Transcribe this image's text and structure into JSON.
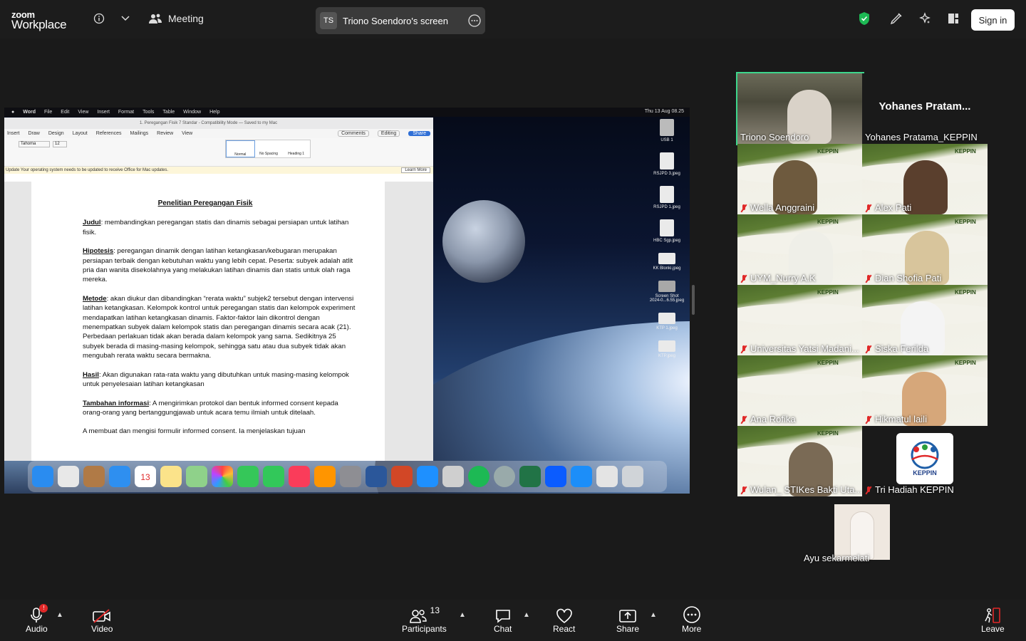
{
  "app": {
    "logo_line1": "zoom",
    "logo_line2": "Workplace",
    "meeting_label": "Meeting",
    "sign_in": "Sign in"
  },
  "screen_share": {
    "initials": "TS",
    "label": "Triono Soendoro's screen"
  },
  "mac": {
    "menu": [
      "Word",
      "File",
      "Edit",
      "View",
      "Insert",
      "Format",
      "Tools",
      "Table",
      "Window",
      "Help"
    ],
    "clock": "Thu 13 Aug 08.25"
  },
  "desktop_icons": [
    "USB 1",
    "RSJPD 3.jpeg",
    "RSJPD 1.jpeg",
    "HBC Sgp.jpeg",
    "KK Blonki.jpeg",
    "Screen Shot 2024-0...6.55.jpeg",
    "KTP 1.jpeg",
    "KTP.jpeg"
  ],
  "word": {
    "title": "1. Peregangan Fisik 7 Standar - Compatibility Mode — Saved to my Mac",
    "tabs": [
      "Insert",
      "Draw",
      "Design",
      "Layout",
      "References",
      "Mailings",
      "Review",
      "View"
    ],
    "font": "Tahoma",
    "size": "12",
    "comments": "Comments",
    "editing": "Editing",
    "share": "Share",
    "styles": [
      "Normal",
      "No Spacing",
      "Heading 1"
    ],
    "update_msg": "Update  Your operating system needs to be updated to receive Office for Mac updates.",
    "learn_more": "Learn More",
    "doc_title": "Penelitian Peregangan Fisik",
    "paragraphs": [
      {
        "label": "Judul",
        "text": ": membandingkan peregangan statis dan dinamis sebagai persiapan untuk latihan fisik."
      },
      {
        "label": "Hipotesis",
        "text": ": peregangan dinamik dengan latihan ketangkasan/kebugaran merupakan persiapan terbaik dengan kebutuhan waktu yang lebih cepat. Peserta: subyek adalah atlit pria dan wanita disekolahnya yang melakukan latihan dinamis dan statis untuk olah raga mereka."
      },
      {
        "label": "Metode",
        "text": ": akan diukur dan dibandingkan “rerata waktu” subjek2 tersebut dengan intervensi latihan ketangkasan. Kelompok kontrol untuk peregangan statis dan kelompok experiment mendapatkan latihan ketangkasan dinamis. Faktor-faktor lain dikontrol dengan menempatkan subyek dalam kelompok statis dan peregangan dinamis secara acak (21). Perbedaan perlakuan tidak akan berada dalam kelompok yang sama. Sedikitnya 25 subyek berada di masing-masing kelompok, sehingga satu atau dua subyek tidak akan mengubah rerata waktu secara bermakna."
      },
      {
        "label": "Hasil",
        "text": ": Akan digunakan rata-rata waktu yang dibutuhkan untuk masing-masing kelompok untuk penyelesaian latihan ketangkasan"
      },
      {
        "label": "Tambahan informasi",
        "text": ": A mengirimkan protokol dan bentuk informed consent kepada orang-orang yang bertanggungjawab untuk acara temu ilmiah untuk ditelaah."
      },
      {
        "label": "",
        "text": "A membuat dan mengisi formulir informed consent. Ia menjelaskan tujuan"
      }
    ]
  },
  "participants": [
    {
      "name": "Triono Soendoro",
      "muted": false,
      "active": true
    },
    {
      "name": "Yohanes Pratama_KEPPIN",
      "muted": false,
      "big_label": "Yohanes  Pratam..."
    },
    {
      "name": "Wella Anggraini",
      "muted": true
    },
    {
      "name": "Alex  Pati",
      "muted": true
    },
    {
      "name": "UYM_Nurry A.K",
      "muted": true
    },
    {
      "name": "Dian Shofia Pati",
      "muted": true
    },
    {
      "name": "Universitas Yatsi Madani...",
      "muted": true
    },
    {
      "name": "Siska Ferilda",
      "muted": true
    },
    {
      "name": "Ana Rofika",
      "muted": true
    },
    {
      "name": "Hikmatul laili",
      "muted": true
    },
    {
      "name": "Wulan_ STIKes Bakti Uta...",
      "muted": true
    },
    {
      "name": "Tri Hadiah KEPPIN",
      "muted": true,
      "logo_text": "KEPPIN"
    },
    {
      "name": "Ayu sekarmelati",
      "muted": false
    }
  ],
  "banner_text": "KEPPIN",
  "toolbar": {
    "audio": "Audio",
    "video": "Video",
    "participants": "Participants",
    "participants_count": "13",
    "chat": "Chat",
    "react": "React",
    "share": "Share",
    "more": "More",
    "leave": "Leave"
  },
  "colors": {
    "active_speaker": "#3dd68c",
    "muted_icon": "#e02828",
    "share_blue": "#2f6fd6",
    "leave_red": "#e02828"
  }
}
